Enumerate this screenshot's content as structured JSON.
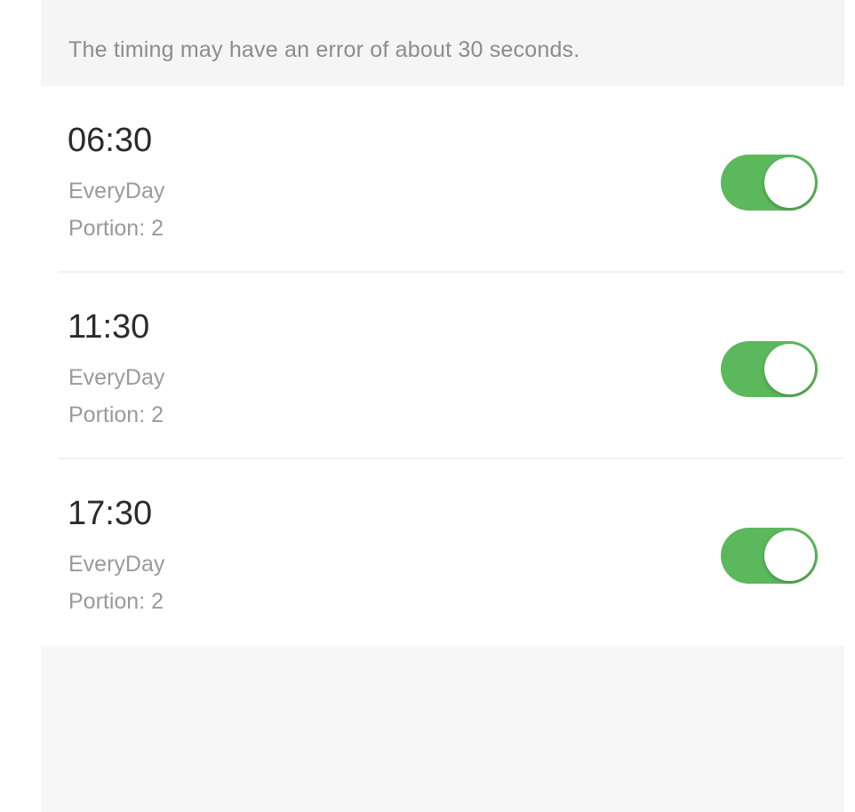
{
  "notice": "The timing may have an error of about 30 seconds.",
  "colors": {
    "toggle_on": "#5cb85c",
    "background": "#f7f7f7"
  },
  "schedules": [
    {
      "time": "06:30",
      "repeat": "EveryDay",
      "portion": "Portion: 2",
      "enabled": true
    },
    {
      "time": "11:30",
      "repeat": "EveryDay",
      "portion": "Portion: 2",
      "enabled": true
    },
    {
      "time": "17:30",
      "repeat": "EveryDay",
      "portion": "Portion: 2",
      "enabled": true
    }
  ]
}
